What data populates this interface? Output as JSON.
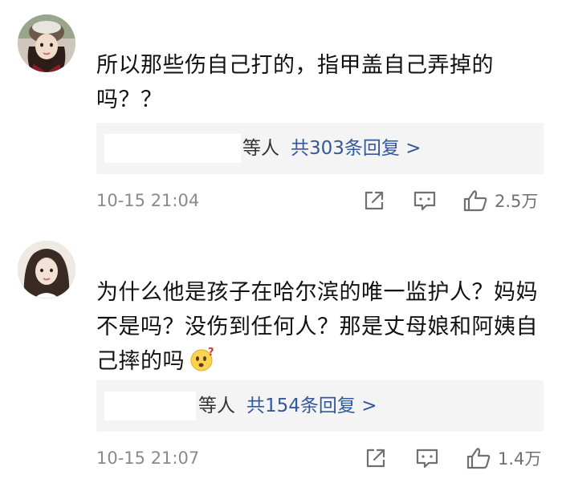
{
  "comments": [
    {
      "text": "所以那些伤自己打的，指甲盖自己弄掉的吗？？",
      "replies": {
        "others_label": "等人",
        "count_label": "共303条回复 >"
      },
      "time": "10-15 21:04",
      "likes": "2.5万",
      "icons": {
        "share": "share-icon",
        "comment": "comment-icon",
        "like": "thumbs-up-icon"
      }
    },
    {
      "text": "为什么他是孩子在哈尔滨的唯一监护人？妈妈不是吗？没伤到任何人？那是丈母娘和阿姨自己摔的吗",
      "replies": {
        "others_label": "等人",
        "count_label": "共154条回复 >"
      },
      "time": "10-15 21:07",
      "likes": "1.4万",
      "icons": {
        "share": "share-icon",
        "comment": "comment-icon",
        "like": "thumbs-up-icon",
        "inline_emoji": "confused-face-emoji"
      }
    }
  ]
}
